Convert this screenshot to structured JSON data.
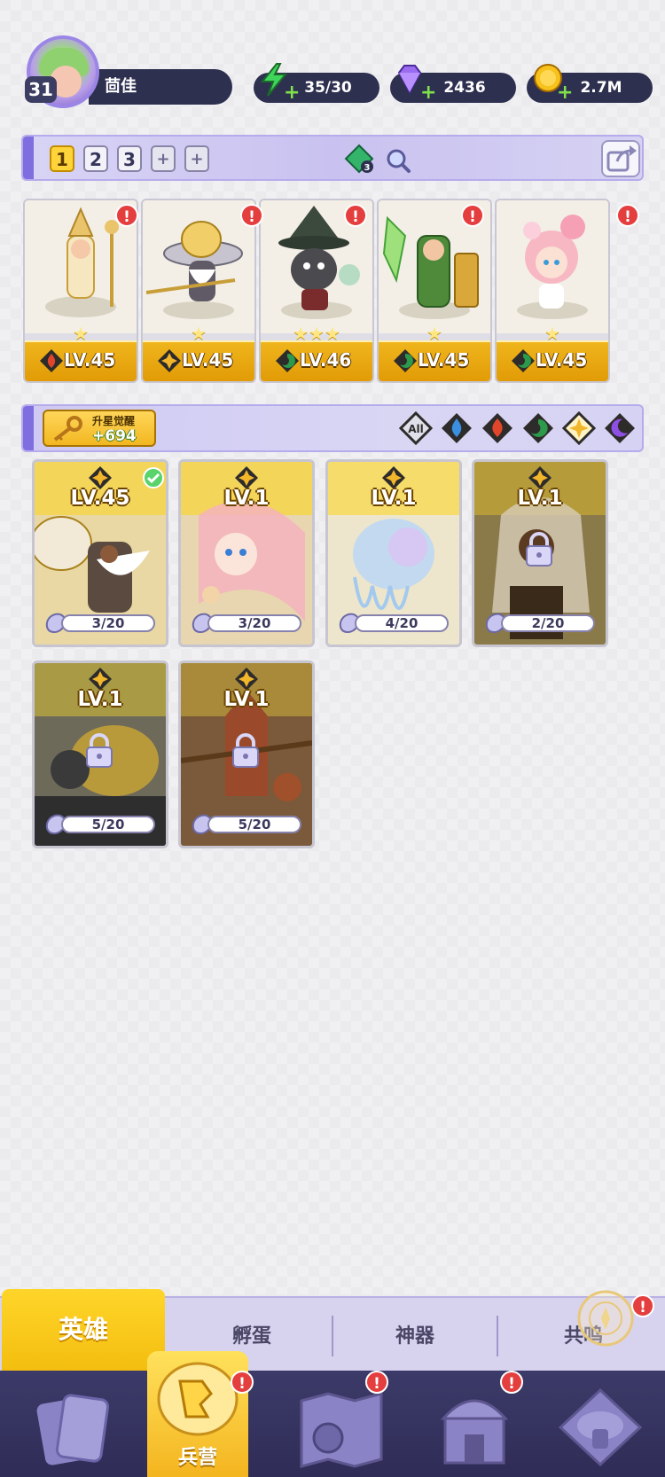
{
  "player": {
    "level": "31",
    "name": "茴佳"
  },
  "resources": {
    "energy": "35/30",
    "gems": "2436",
    "gold": "2.7M"
  },
  "team_bar": {
    "tabs": [
      "1",
      "2",
      "3"
    ],
    "gem_swap_count": "3"
  },
  "team_heroes": [
    {
      "level": "LV.45",
      "element": "fire",
      "stars": "★"
    },
    {
      "level": "LV.45",
      "element": "light",
      "stars": "★"
    },
    {
      "level": "LV.46",
      "element": "nature",
      "stars": "★★★"
    },
    {
      "level": "LV.45",
      "element": "nature",
      "stars": "★"
    },
    {
      "level": "LV.45",
      "element": "nature",
      "stars": "★"
    }
  ],
  "filter_bar": {
    "awaken_label": "升星觉醒",
    "awaken_count": "+694",
    "filters": [
      "All",
      "water",
      "fire",
      "nature",
      "light",
      "dark"
    ],
    "selected_filter": "light"
  },
  "hero_list": [
    {
      "level": "LV.45",
      "progress": "3/20",
      "locked": false,
      "equipped": true
    },
    {
      "level": "LV.1",
      "progress": "3/20",
      "locked": false,
      "equipped": false
    },
    {
      "level": "LV.1",
      "progress": "4/20",
      "locked": false,
      "equipped": false
    },
    {
      "level": "LV.1",
      "progress": "2/20",
      "locked": true,
      "equipped": false
    },
    {
      "level": "LV.1",
      "progress": "5/20",
      "locked": true,
      "equipped": false
    },
    {
      "level": "LV.1",
      "progress": "5/20",
      "locked": true,
      "equipped": false
    }
  ],
  "sub_tabs": [
    "英雄",
    "孵蛋",
    "神器",
    "共鸣"
  ],
  "nav": {
    "active_label": "兵营",
    "items": [
      "cards-icon",
      "barracks-icon",
      "map-icon",
      "temple-icon",
      "mushroom-icon"
    ]
  },
  "colors": {
    "fire": "#e2462a",
    "nature": "#2c9a4b",
    "light": "#f2b62a",
    "water": "#3a8fe0",
    "dark": "#7b3fd1",
    "accent": "#ffd43b"
  }
}
